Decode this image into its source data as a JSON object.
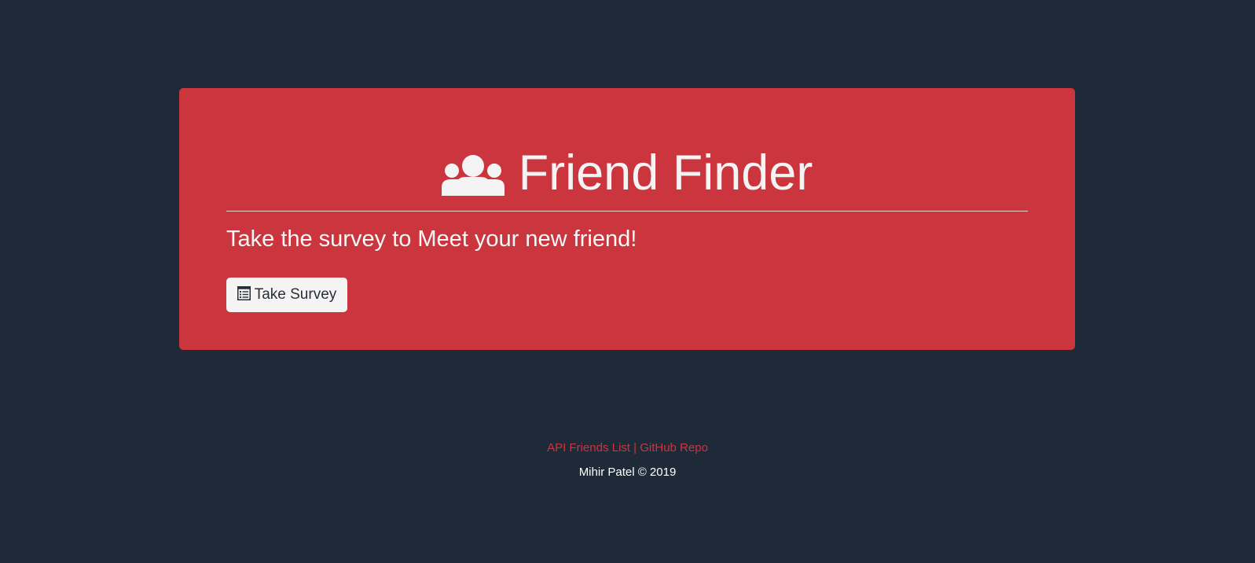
{
  "hero": {
    "title": "Friend Finder",
    "title_icon": "users-icon",
    "lead": "Take the survey to Meet your new friend!",
    "button_label": "Take Survey",
    "button_icon": "list-alt-icon"
  },
  "footer": {
    "link_api": "API Friends List",
    "separator": "|",
    "link_github": "GitHub Repo",
    "copyright": "Mihir Patel © 2019"
  },
  "colors": {
    "background": "#1e2a38",
    "accent": "#cb353d",
    "button_bg": "#f4f4f4"
  }
}
